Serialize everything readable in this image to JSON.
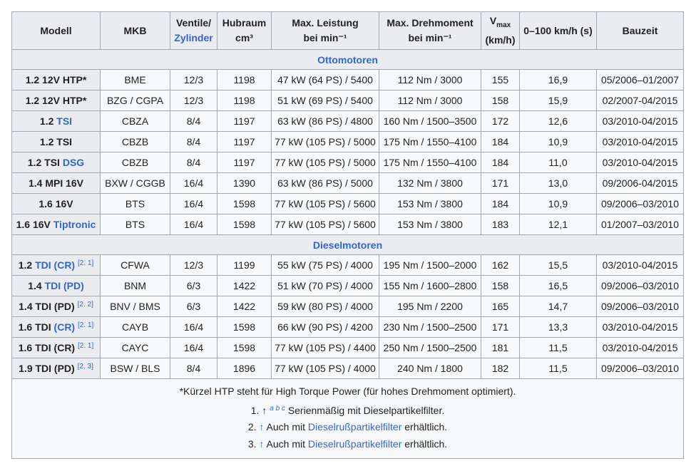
{
  "headers": {
    "modell": "Modell",
    "mkb": "MKB",
    "ventile": "Ventile/",
    "zylinder": "Zylinder",
    "hubraum": "Hubraum",
    "cm3": "cm³",
    "leistung": "Max. Leistung",
    "leistung_unit": "bei min⁻¹",
    "drehmoment": "Max. Drehmoment",
    "drehmoment_unit": "bei min⁻¹",
    "vmax": "V",
    "vmax_sub": "max",
    "vmax_unit": "(km/h)",
    "accel": "0–100 km/h (s)",
    "bauzeit": "Bauzeit"
  },
  "sections": [
    {
      "title": "Ottomotoren",
      "rows": [
        {
          "model": [
            {
              "t": "1.2 12V HTP*"
            }
          ],
          "ref": "",
          "mkb": "BME",
          "vz": "12/3",
          "hub": "1198",
          "power": "47 kW (64 PS) / 5400",
          "torque": "112 Nm / 3000",
          "vmax": "155",
          "accel": "16,9",
          "years": "05/2006–01/2007"
        },
        {
          "model": [
            {
              "t": "1.2 12V HTP*"
            }
          ],
          "ref": "",
          "mkb": "BZG / CGPA",
          "vz": "12/3",
          "hub": "1198",
          "power": "51 kW (69 PS) / 5400",
          "torque": "112 Nm / 3000",
          "vmax": "158",
          "accel": "15,9",
          "years": "02/2007-04/2015"
        },
        {
          "model": [
            {
              "t": "1.2 "
            },
            {
              "t": "TSI",
              "link": true
            }
          ],
          "ref": "",
          "mkb": "CBZA",
          "vz": "8/4",
          "hub": "1197",
          "power": "63 kW (86 PS) / 4800",
          "torque": "160 Nm / 1500–3500",
          "vmax": "172",
          "accel": "12,6",
          "years": "03/2010-04/2015"
        },
        {
          "model": [
            {
              "t": "1.2 TSI"
            }
          ],
          "ref": "",
          "mkb": "CBZB",
          "vz": "8/4",
          "hub": "1197",
          "power": "77 kW (105 PS) / 5000",
          "torque": "175 Nm / 1550–4100",
          "vmax": "184",
          "accel": "10,9",
          "years": "03/2010-04/2015"
        },
        {
          "model": [
            {
              "t": "1.2 TSI "
            },
            {
              "t": "DSG",
              "link": true
            }
          ],
          "ref": "",
          "mkb": "CBZB",
          "vz": "8/4",
          "hub": "1197",
          "power": "77 kW (105 PS) / 5000",
          "torque": "175 Nm / 1550–4100",
          "vmax": "184",
          "accel": "11,0",
          "years": "03/2010-04/2015"
        },
        {
          "model": [
            {
              "t": "1.4 MPI 16V"
            }
          ],
          "ref": "",
          "mkb": "BXW / CGGB",
          "vz": "16/4",
          "hub": "1390",
          "power": "63 kW (86 PS) / 5000",
          "torque": "132 Nm / 3800",
          "vmax": "171",
          "accel": "13,0",
          "years": "09/2006-04/2015"
        },
        {
          "model": [
            {
              "t": "1.6 16V"
            }
          ],
          "ref": "",
          "mkb": "BTS",
          "vz": "16/4",
          "hub": "1598",
          "power": "77 kW (105 PS) / 5600",
          "torque": "153 Nm / 3800",
          "vmax": "184",
          "accel": "10,9",
          "years": "09/2006–03/2010"
        },
        {
          "model": [
            {
              "t": "1.6 16V "
            },
            {
              "t": "Tiptronic",
              "link": true
            }
          ],
          "ref": "",
          "mkb": "BTS",
          "vz": "16/4",
          "hub": "1598",
          "power": "77 kW (105 PS) / 5600",
          "torque": "153 Nm / 3800",
          "vmax": "183",
          "accel": "12,1",
          "years": "01/2007–03/2010"
        }
      ]
    },
    {
      "title": "Dieselmotoren",
      "rows": [
        {
          "model": [
            {
              "t": "1.2 "
            },
            {
              "t": "TDI (CR)",
              "link": true
            }
          ],
          "ref": "[2. 1]",
          "mkb": "CFWA",
          "vz": "12/3",
          "hub": "1199",
          "power": "55 kW (75 PS) / 4000",
          "torque": "195 Nm / 1500–2000",
          "vmax": "162",
          "accel": "15,5",
          "years": "03/2010-04/2015"
        },
        {
          "model": [
            {
              "t": "1.4 "
            },
            {
              "t": "TDI (PD)",
              "link": true
            }
          ],
          "ref": "",
          "mkb": "BNM",
          "vz": "6/3",
          "hub": "1422",
          "power": "51 kW (70 PS) / 4000",
          "torque": "155 Nm / 1600–2800",
          "vmax": "158",
          "accel": "16,5",
          "years": "09/2006–03/2010"
        },
        {
          "model": [
            {
              "t": "1.4 TDI (PD)"
            }
          ],
          "ref": "[2. 2]",
          "mkb": "BNV / BMS",
          "vz": "6/3",
          "hub": "1422",
          "power": "59 kW (80 PS) / 4000",
          "torque": "195 Nm / 2200",
          "vmax": "165",
          "accel": "14,7",
          "years": "09/2006–03/2010"
        },
        {
          "model": [
            {
              "t": "1.6 TDI "
            },
            {
              "t": "(CR)",
              "link": true
            }
          ],
          "ref": "[2. 1]",
          "mkb": "CAYB",
          "vz": "16/4",
          "hub": "1598",
          "power": "66 kW (90 PS) / 4200",
          "torque": "230 Nm / 1500–2500",
          "vmax": "171",
          "accel": "13,3",
          "years": "03/2010-04/2015"
        },
        {
          "model": [
            {
              "t": "1.6 TDI (CR)"
            }
          ],
          "ref": "[2. 1]",
          "mkb": "CAYC",
          "vz": "16/4",
          "hub": "1598",
          "power": "77 kW (105 PS) / 4400",
          "torque": "250 Nm / 1500–2500",
          "vmax": "181",
          "accel": "11,5",
          "years": "03/2010-04/2015"
        },
        {
          "model": [
            {
              "t": "1.9 TDI (PD)"
            }
          ],
          "ref": "[2. 3]",
          "mkb": "BSW / BLS",
          "vz": "8/4",
          "hub": "1896",
          "power": "77 kW (105 PS) / 4000",
          "torque": "240 Nm / 1800",
          "vmax": "182",
          "accel": "11,5",
          "years": "09/2006–03/2010"
        }
      ]
    }
  ],
  "footer": {
    "note": "*Kürzel HTP steht für High Torque Power (für hohes Drehmoment optimiert).",
    "refs": [
      {
        "num": "1.",
        "arrow": "↑",
        "backlinks": "a b c",
        "text": "Serienmäßig mit Dieselpartikelfilter.",
        "link": "",
        "after": ""
      },
      {
        "num": "2.",
        "arrow": "↑",
        "backlinks": "",
        "text": "Auch mit ",
        "link": "Dieselrußpartikelfilter",
        "after": " erhältlich."
      },
      {
        "num": "3.",
        "arrow": "↑",
        "backlinks": "",
        "text": "Auch mit ",
        "link": "Dieselrußpartikelfilter",
        "after": " erhältlich."
      }
    ]
  }
}
